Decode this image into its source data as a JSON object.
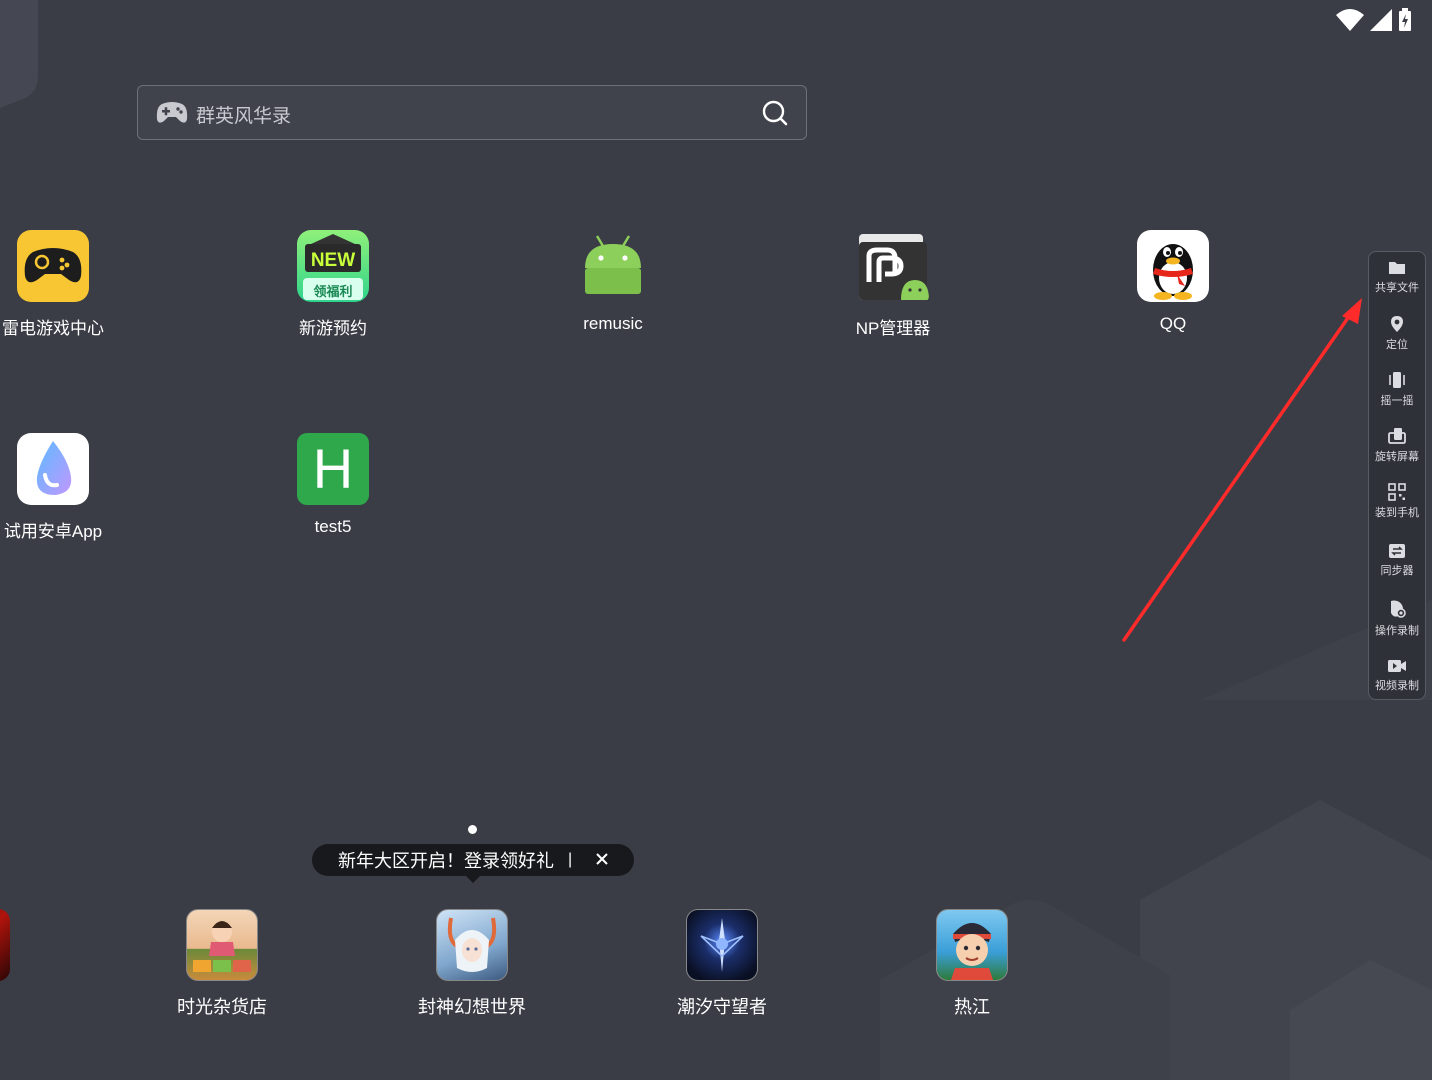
{
  "search": {
    "placeholder": "群英风华录"
  },
  "apps": [
    {
      "label": "雷电游戏中心"
    },
    {
      "label": "新游预约",
      "badge_top": "NEW",
      "badge_bottom": "领福利"
    },
    {
      "label": "remusic"
    },
    {
      "label": "NP管理器"
    },
    {
      "label": "QQ"
    },
    {
      "label": "试用安卓App"
    },
    {
      "label": "test5",
      "glyph": "H"
    }
  ],
  "toolbar": {
    "items": [
      {
        "label": "共享文件",
        "icon": "folder-icon"
      },
      {
        "label": "定位",
        "icon": "location-pin-icon"
      },
      {
        "label": "摇一摇",
        "icon": "shake-phone-icon"
      },
      {
        "label": "旋转屏幕",
        "icon": "rotate-screen-icon"
      },
      {
        "label": "装到手机",
        "icon": "qr-code-icon"
      },
      {
        "label": "同步器",
        "icon": "sync-icon"
      },
      {
        "label": "操作录制",
        "icon": "macro-record-icon"
      },
      {
        "label": "视频录制",
        "icon": "video-record-icon"
      }
    ]
  },
  "tooltip": {
    "text": "新年大区开启！登录领好礼",
    "separator": "|"
  },
  "dock": [
    {
      "label": "时光杂货店"
    },
    {
      "label": "封神幻想世界"
    },
    {
      "label": "潮汐守望者"
    },
    {
      "label": "热江"
    }
  ],
  "colors": {
    "background": "#3a3d46",
    "annotation_arrow": "#ff2a2a",
    "test5_green": "#2ea84a",
    "leidian_yellow": "#f7c632"
  }
}
